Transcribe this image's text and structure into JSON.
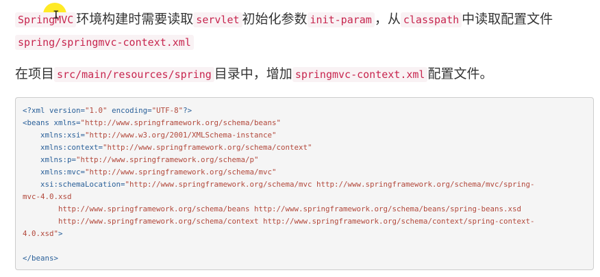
{
  "paragraph1": {
    "code1": "SpringMVC",
    "text1": "环境构建时需要读取",
    "code2": "servlet",
    "text2": "初始化参数",
    "code3": "init-param",
    "text3": "，从",
    "code4": "classpath",
    "text4": "中读取配置文件",
    "code5": "spring/springmvc-context.xml"
  },
  "paragraph2": {
    "text1": "在项目",
    "code1": "src/main/resources/spring",
    "text2": "目录中，增加",
    "code2": "springmvc-context.xml",
    "text3": "配置文件。"
  },
  "code_block": {
    "lines": [
      [
        {
          "t": "decl",
          "v": "<?xml "
        },
        {
          "t": "attr",
          "v": "version="
        },
        {
          "t": "val",
          "v": "\"1.0\""
        },
        {
          "t": "plain",
          "v": " "
        },
        {
          "t": "attr",
          "v": "encoding="
        },
        {
          "t": "val",
          "v": "\"UTF-8\""
        },
        {
          "t": "decl",
          "v": "?>"
        }
      ],
      [
        {
          "t": "tag",
          "v": "<beans "
        },
        {
          "t": "attr",
          "v": "xmlns="
        },
        {
          "t": "val",
          "v": "\"http://www.springframework.org/schema/beans\""
        }
      ],
      [
        {
          "t": "plain",
          "v": "    "
        },
        {
          "t": "attr",
          "v": "xmlns:xsi="
        },
        {
          "t": "val",
          "v": "\"http://www.w3.org/2001/XMLSchema-instance\""
        }
      ],
      [
        {
          "t": "plain",
          "v": "    "
        },
        {
          "t": "attr",
          "v": "xmlns:context="
        },
        {
          "t": "val",
          "v": "\"http://www.springframework.org/schema/context\""
        }
      ],
      [
        {
          "t": "plain",
          "v": "    "
        },
        {
          "t": "attr",
          "v": "xmlns:p="
        },
        {
          "t": "val",
          "v": "\"http://www.springframework.org/schema/p\""
        }
      ],
      [
        {
          "t": "plain",
          "v": "    "
        },
        {
          "t": "attr",
          "v": "xmlns:mvc="
        },
        {
          "t": "val",
          "v": "\"http://www.springframework.org/schema/mvc\""
        }
      ],
      [
        {
          "t": "plain",
          "v": "    "
        },
        {
          "t": "attr",
          "v": "xsi:schemaLocation="
        },
        {
          "t": "val",
          "v": "\"http://www.springframework.org/schema/mvc http://www.springframework.org/schema/mvc/spring-"
        }
      ],
      [
        {
          "t": "val",
          "v": "mvc-4.0.xsd"
        }
      ],
      [
        {
          "t": "plain",
          "v": "        "
        },
        {
          "t": "val",
          "v": "http://www.springframework.org/schema/beans http://www.springframework.org/schema/beans/spring-beans.xsd"
        }
      ],
      [
        {
          "t": "plain",
          "v": "        "
        },
        {
          "t": "val",
          "v": "http://www.springframework.org/schema/context http://www.springframework.org/schema/context/spring-context-"
        }
      ],
      [
        {
          "t": "val",
          "v": "4.0.xsd\""
        },
        {
          "t": "tag",
          "v": ">"
        }
      ],
      [],
      [
        {
          "t": "tag",
          "v": "</beans>"
        }
      ]
    ]
  }
}
